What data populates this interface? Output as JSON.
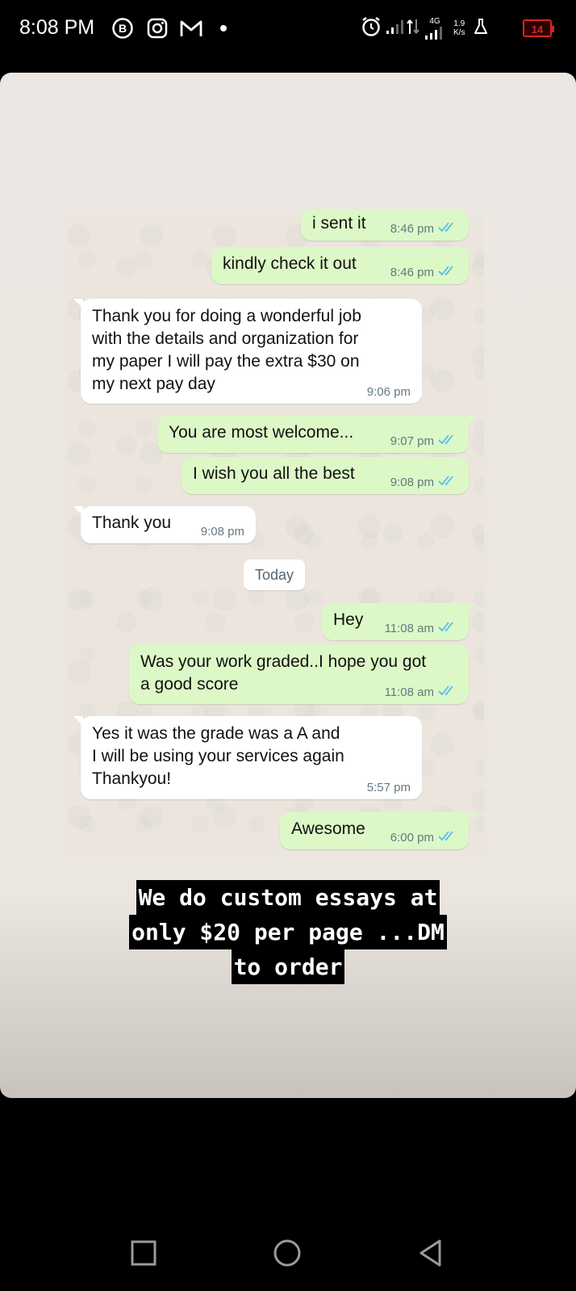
{
  "status_bar": {
    "time": "8:08 PM",
    "app_icons": [
      "b-circle-icon",
      "instagram-icon",
      "gmail-icon",
      "dot-icon"
    ],
    "network_label": "4G",
    "speed_value": "1.9",
    "speed_unit": "K/s",
    "battery_level": "14"
  },
  "chat": {
    "messages": [
      {
        "dir": "out",
        "text": "i sent it",
        "time": "8:46 pm",
        "read": true
      },
      {
        "dir": "out",
        "text": "kindly check it out",
        "time": "8:46 pm",
        "read": true
      },
      {
        "dir": "in",
        "text": "Thank you for doing a wonderful job\nwith the details and organization for\nmy paper I will pay the extra $30 on\nmy next pay day",
        "time": "9:06 pm"
      },
      {
        "dir": "out",
        "text": "You are most welcome...",
        "time": "9:07 pm",
        "read": true
      },
      {
        "dir": "out",
        "text": "I wish you all the best",
        "time": "9:08 pm",
        "read": true
      },
      {
        "dir": "in",
        "text": "Thank you",
        "time": "9:08 pm"
      },
      {
        "dir": "out",
        "text": "Hey",
        "time": "11:08 am",
        "read": true
      },
      {
        "dir": "out",
        "text": "Was your work graded..I hope you got\na good score",
        "time": "11:08 am",
        "read": true
      },
      {
        "dir": "in",
        "text": "Yes it was the grade was a A and\nI will be using your services again\nThankyou!",
        "time": "5:57 pm"
      },
      {
        "dir": "out",
        "text": "Awesome",
        "time": "6:00 pm",
        "read": true
      }
    ],
    "date_divider": "Today"
  },
  "caption": {
    "lines": [
      "We do custom essays at",
      "only $20 per page ...DM",
      "to order"
    ]
  },
  "colors": {
    "outgoing_bubble": "#dcf8c6",
    "incoming_bubble": "#ffffff",
    "read_tick": "#53bdeb",
    "battery_low": "#d7261f"
  }
}
